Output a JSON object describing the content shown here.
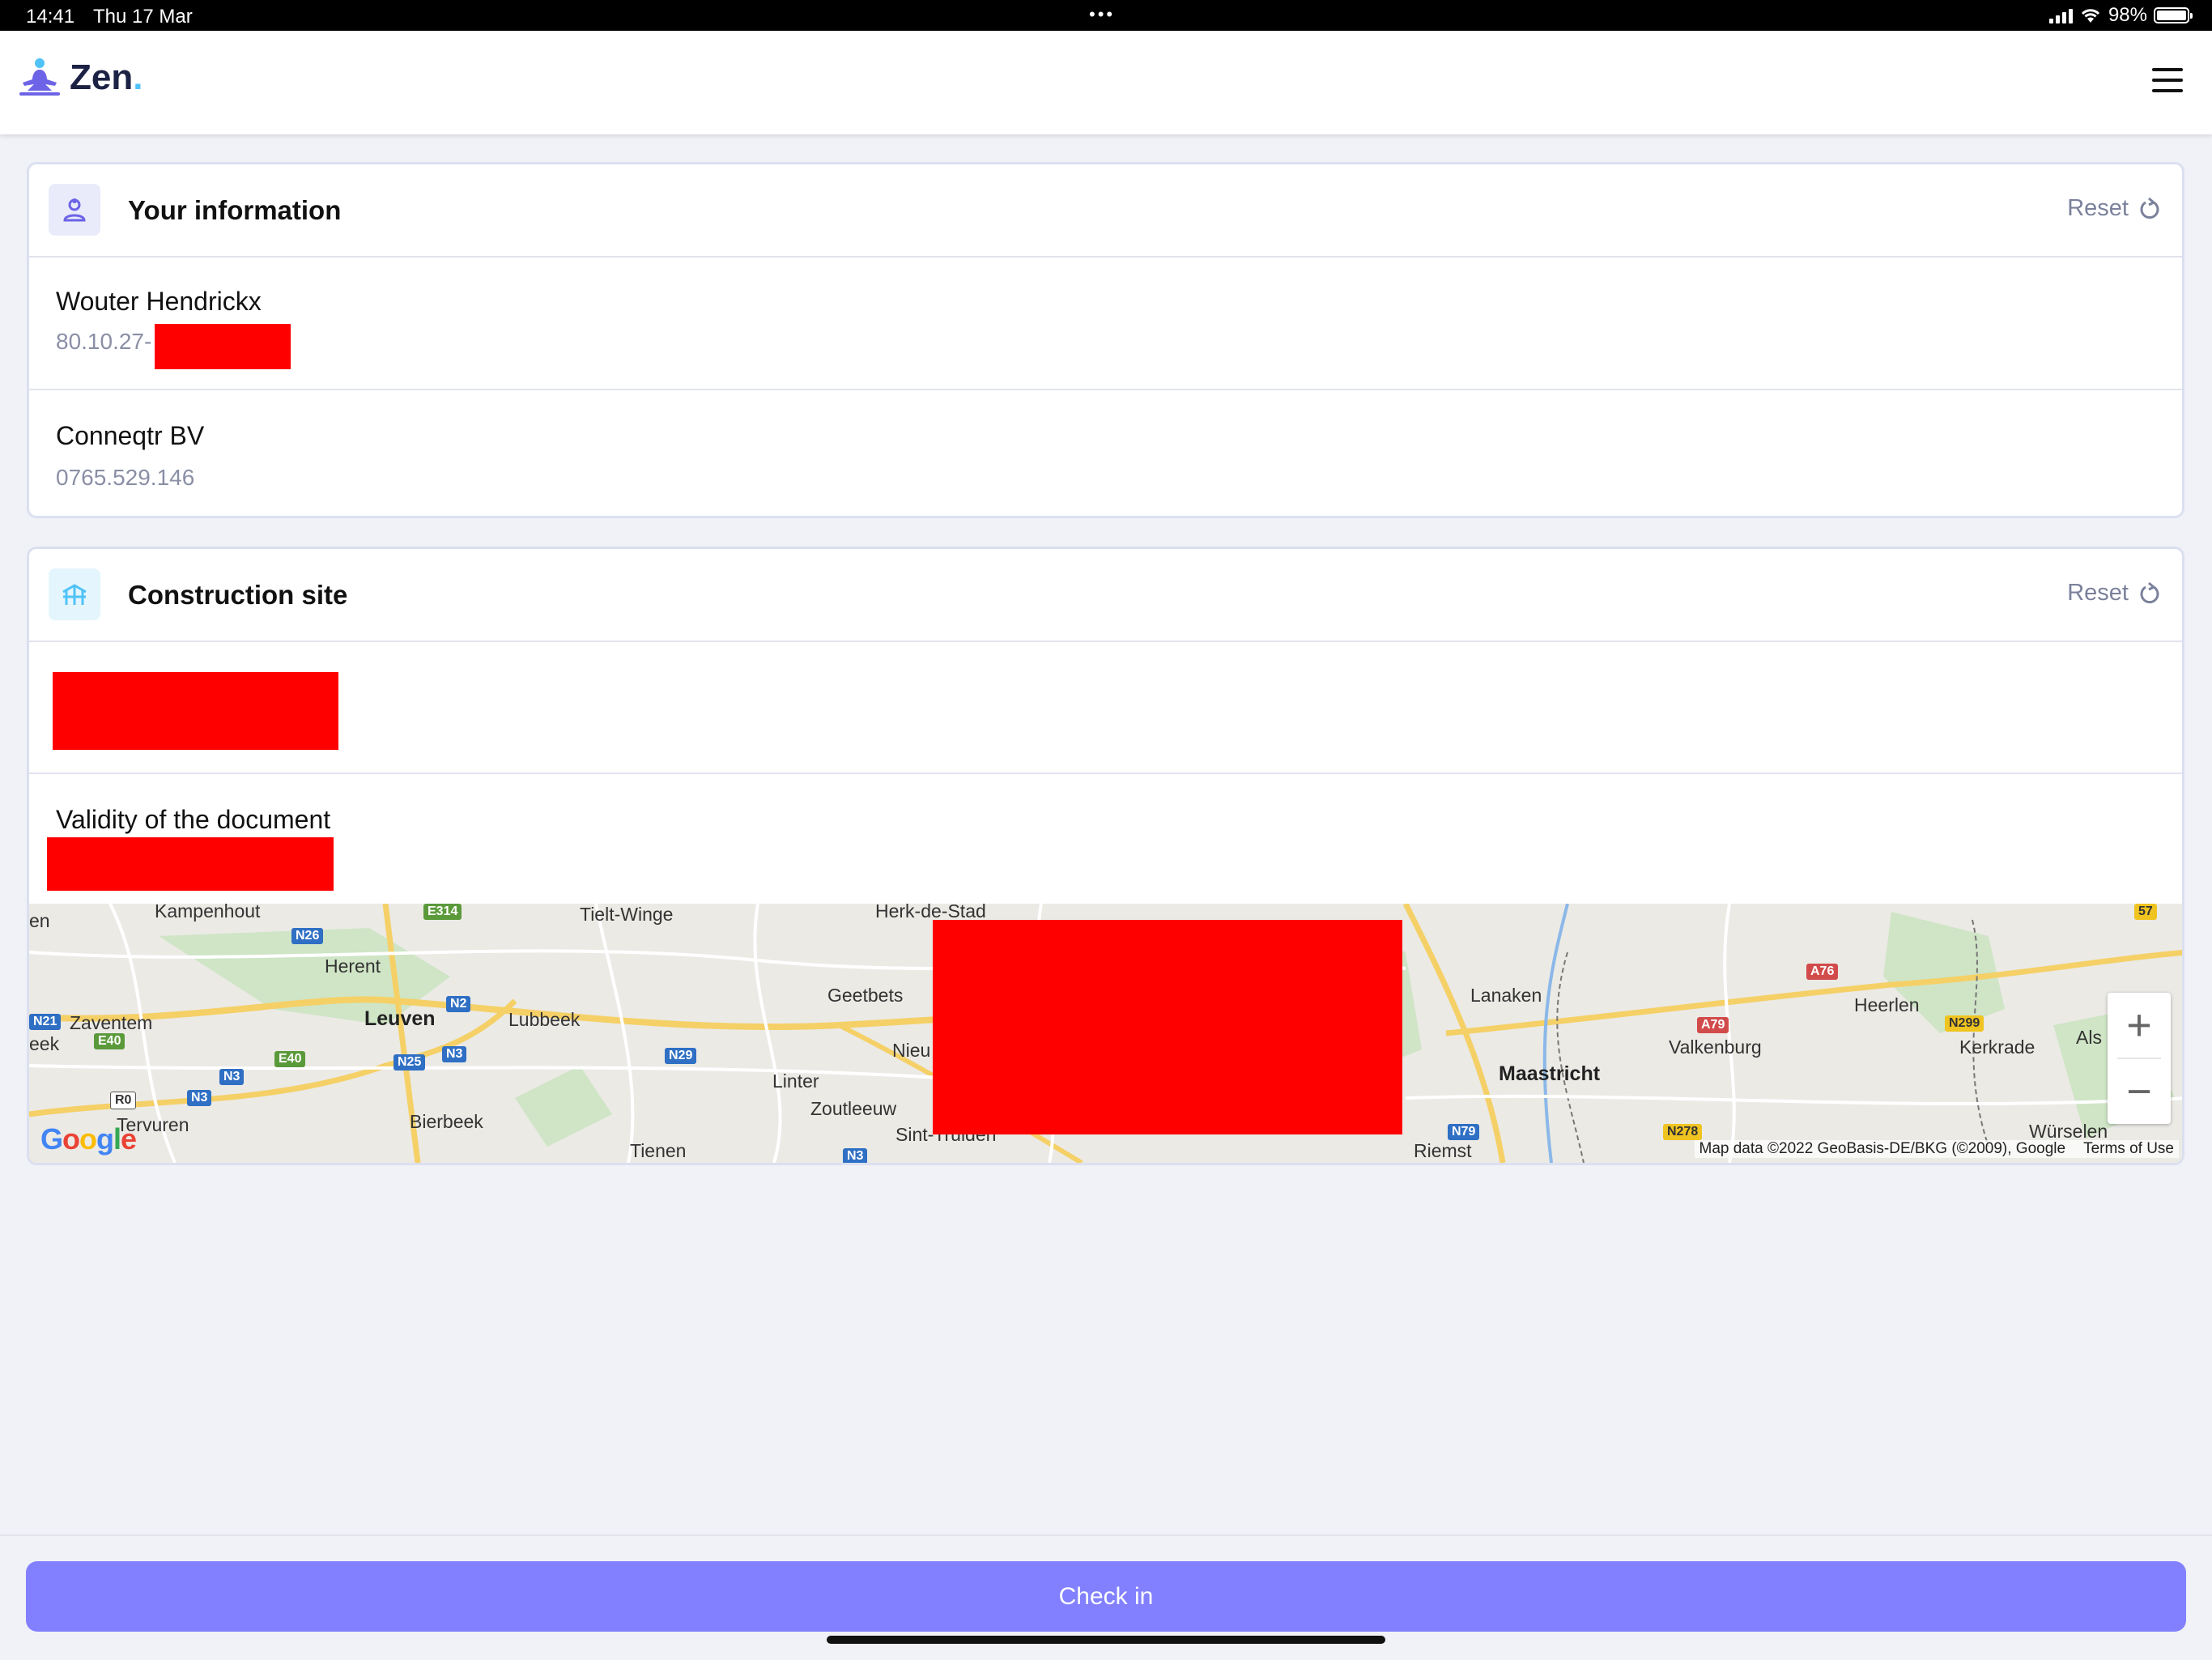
{
  "status_bar": {
    "time": "14:41",
    "date": "Thu 17 Mar",
    "battery": "98%",
    "battery_level": 0.98
  },
  "header": {
    "logo_text": "Zen",
    "logo_dot": ".",
    "menu_icon": "hamburger-menu-icon"
  },
  "your_information": {
    "title": "Your information",
    "reset_label": "Reset",
    "icon": "user-icon",
    "person": {
      "name": "Wouter Hendrickx",
      "id_visible": "80.10.27-"
    },
    "company": {
      "name": "Conneqtr BV",
      "number": "0765.529.146"
    }
  },
  "construction_site": {
    "title": "Construction site",
    "reset_label": "Reset",
    "icon": "construction-site-icon",
    "validity_label": "Validity of the document"
  },
  "map": {
    "labels": [
      "Kampenhout",
      "Tielt-Winge",
      "Herk-de-Stad",
      "Herent",
      "Zaventem",
      "Leuven",
      "Lubbeek",
      "Geetbets",
      "Linter",
      "Zoutleeuw",
      "Tervuren",
      "Bierbeek",
      "Tienen",
      "Sint-Truiden",
      "Lanaken",
      "Maastricht",
      "Valkenburg",
      "Heerlen",
      "Kerkrade",
      "Würselen",
      "Riemst",
      "Nieu",
      "Als",
      "en",
      "eek"
    ],
    "shields": [
      "E314",
      "N26",
      "N2",
      "N21",
      "E40",
      "E40",
      "N25",
      "N3",
      "N3",
      "N3",
      "R0",
      "N29",
      "N3",
      "A76",
      "A79",
      "N299",
      "N79",
      "N278",
      "57"
    ],
    "attribution": "Map data ©2022 GeoBasis-DE/BKG (©2009), Google",
    "terms": "Terms of Use",
    "google_logo": "Google",
    "zoom_in": "+",
    "zoom_out": "−"
  },
  "footer": {
    "checkin_label": "Check in"
  },
  "colors": {
    "accent": "#8280ff",
    "redaction": "#ff0000",
    "secondary_text": "#8a8fa6"
  }
}
